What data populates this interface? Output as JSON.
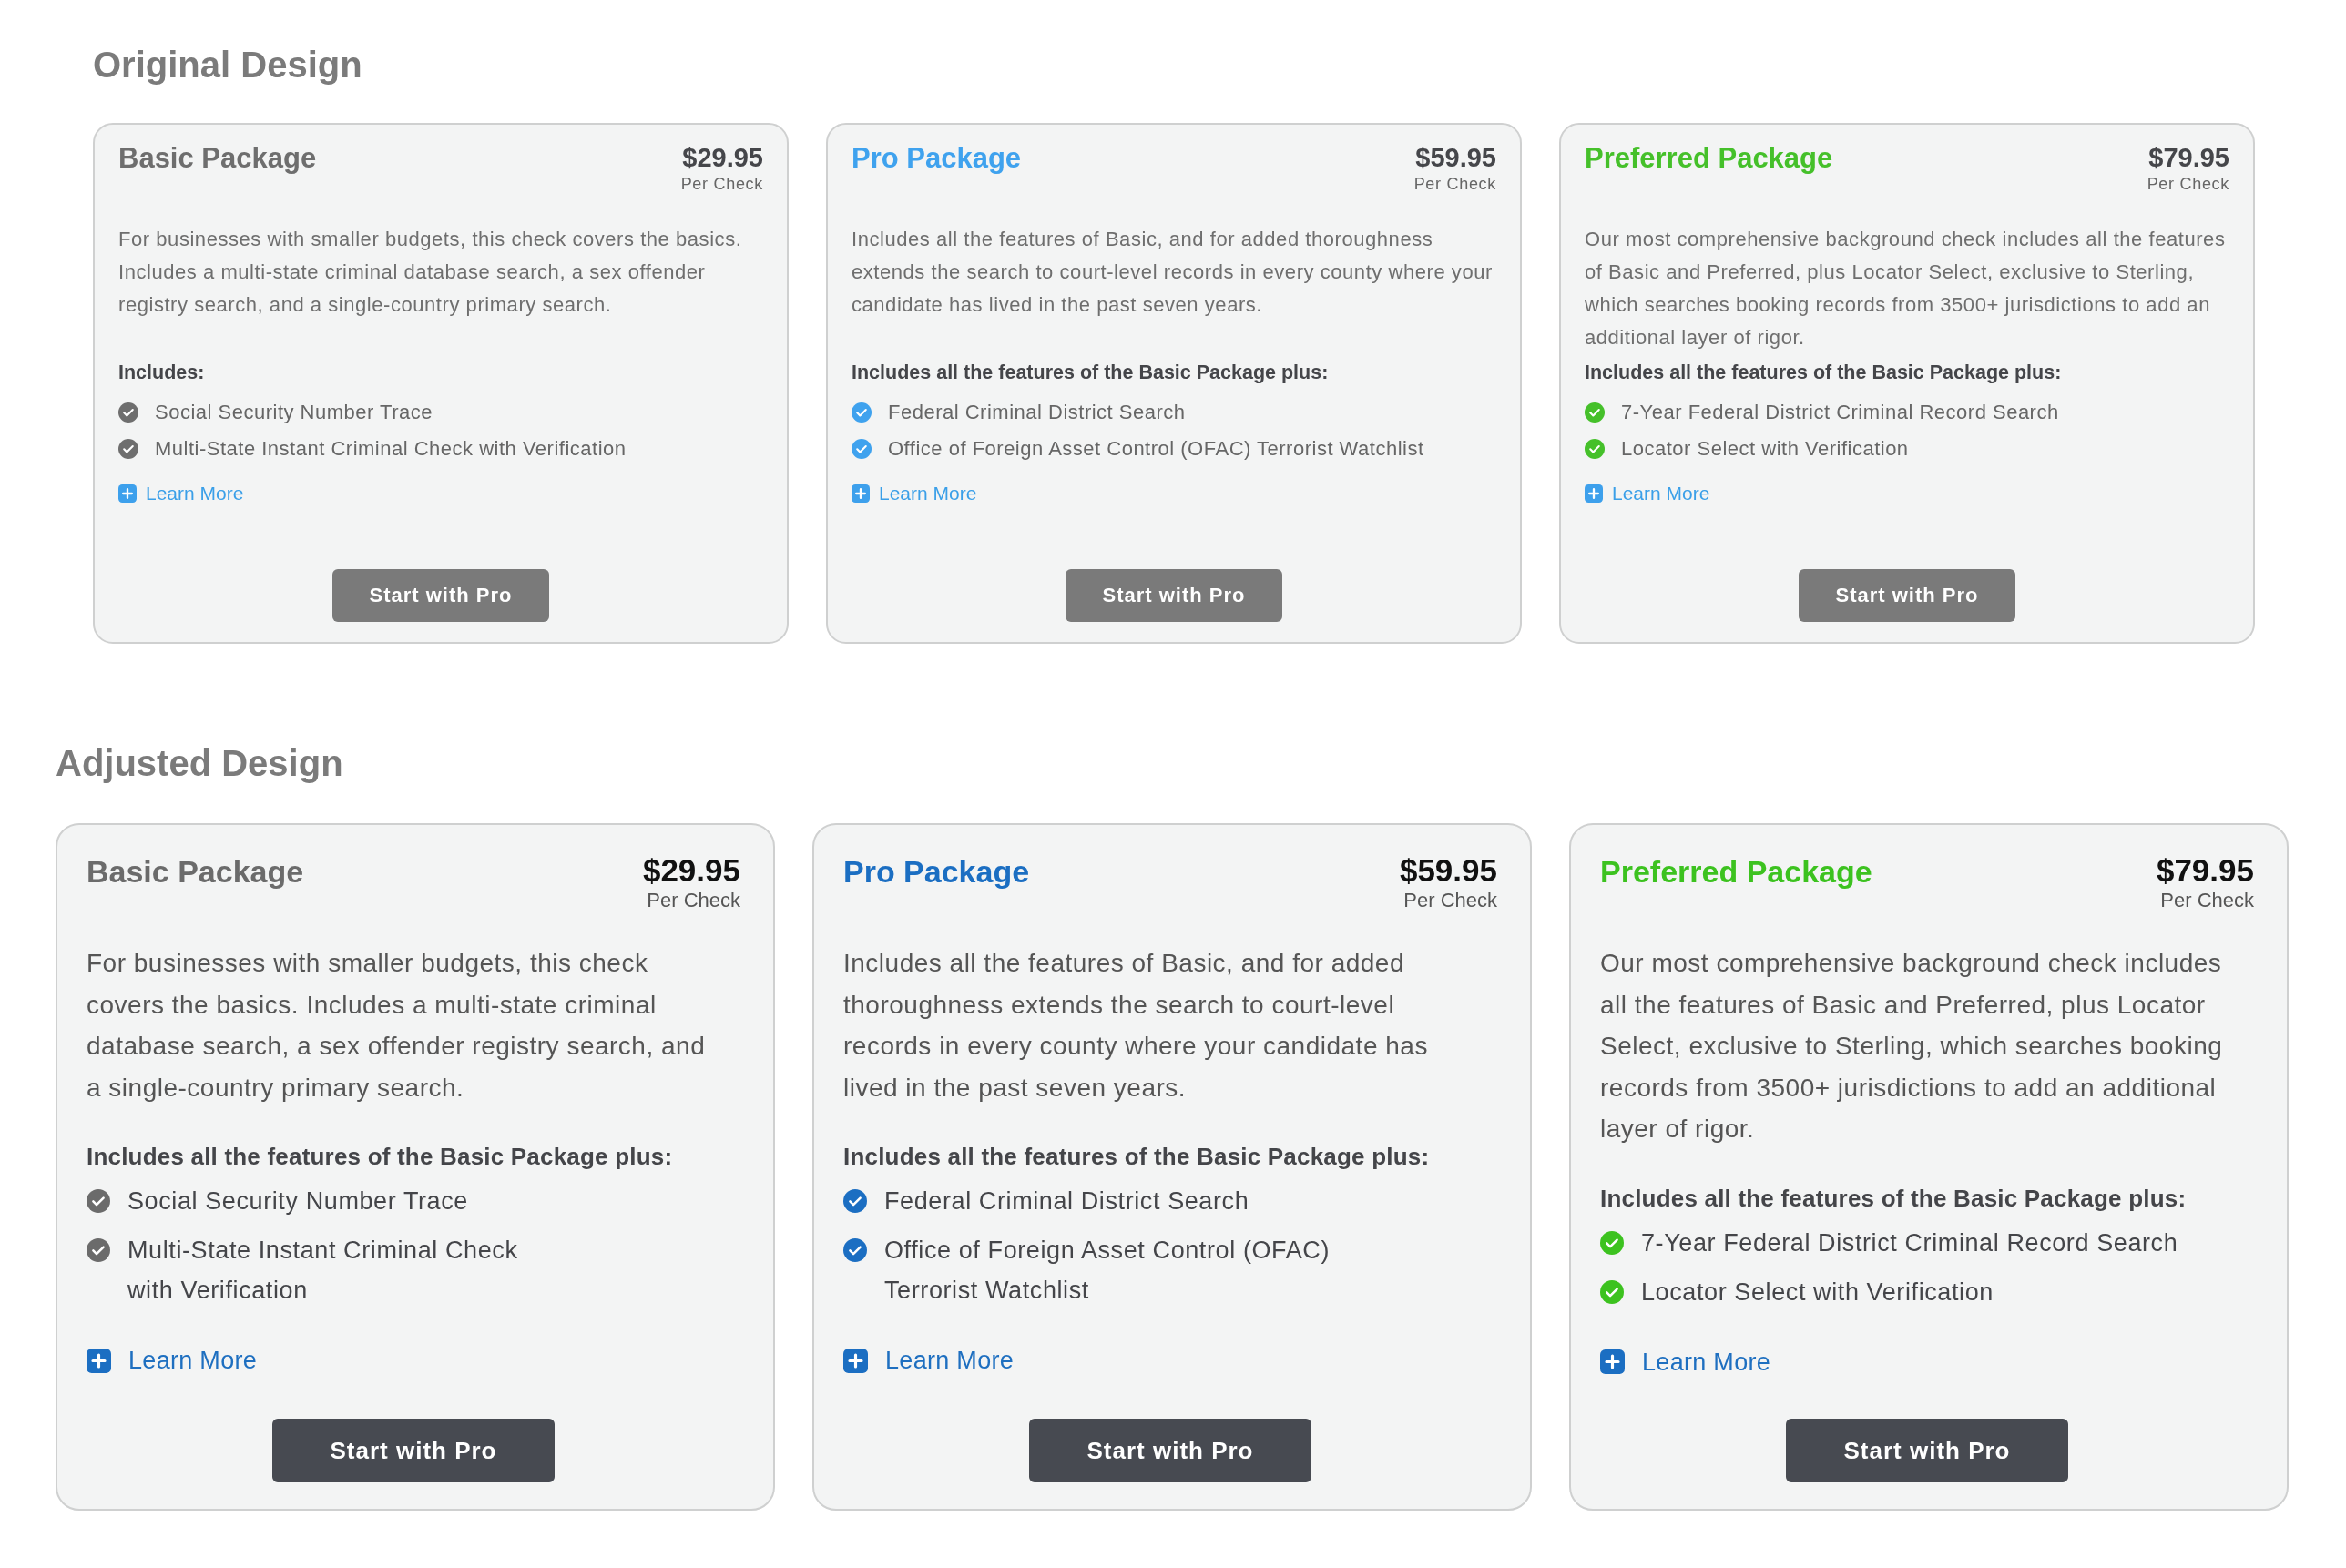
{
  "sections": [
    {
      "title": "Original Design",
      "kind": "small",
      "cards": [
        {
          "name": "Basic Package",
          "color": "#6e6e6e",
          "price": "$29.95",
          "price_unit": "Per Check",
          "description": "For businesses with smaller budgets, this check covers the basics. Includes a multi-state criminal database search, a sex offender registry search, and a single-country primary search.",
          "features_heading": "Includes:",
          "features": [
            "Social Security Number Trace",
            "Multi-State Instant Criminal Check with Verification"
          ],
          "link": "Learn More",
          "button": "Start with Pro"
        },
        {
          "name": "Pro Package",
          "color": "#3fa2ee",
          "price": "$59.95",
          "price_unit": "Per Check",
          "description": "Includes all the features of Basic, and for added thoroughness extends the search to court-level records in every county where your candidate has lived in the past seven years.",
          "features_heading": "Includes all the features of the Basic Package plus:",
          "features": [
            "Federal Criminal District Search",
            "Office of Foreign Asset Control (OFAC) Terrorist Watchlist"
          ],
          "link": "Learn More",
          "button": "Start with Pro"
        },
        {
          "name": "Preferred Package",
          "color": "#45c02a",
          "price": "$79.95",
          "price_unit": "Per Check",
          "description": "Our most comprehensive background check includes all the features of Basic and Preferred, plus Locator Select, exclusive to Sterling, which searches booking records from 3500+ jurisdictions to add an additional layer of rigor.",
          "features_heading": "Includes all the features of the Basic Package plus:",
          "features": [
            "7-Year Federal District Criminal Record Search",
            "Locator Select with Verification"
          ],
          "link": "Learn More",
          "button": "Start with Pro"
        }
      ]
    },
    {
      "title": "Adjusted Design",
      "kind": "large",
      "cards": [
        {
          "name": "Basic Package",
          "color": "#6b6b6b",
          "price": "$29.95",
          "price_unit": "Per Check",
          "description": "For businesses with smaller budgets, this check covers the basics. Includes a multi-state criminal database search, a sex offender registry search, and a single-country primary search.",
          "features_heading": "Includes all the features of the Basic Package plus:",
          "features": [
            "Social Security Number Trace",
            "Multi-State Instant Criminal Check\nwith Verification"
          ],
          "link": "Learn More",
          "button": "Start with Pro"
        },
        {
          "name": "Pro Package",
          "color": "#1b6ec2",
          "price": "$59.95",
          "price_unit": "Per Check",
          "description": "Includes all the features of Basic, and for added thoroughness extends the search to court-level records in every county where your candidate has lived in the past seven years.",
          "features_heading": "Includes all the features of the Basic Package plus:",
          "features": [
            "Federal Criminal District Search",
            "Office of Foreign Asset Control (OFAC)\nTerrorist Watchlist"
          ],
          "link": "Learn More",
          "button": "Start with Pro"
        },
        {
          "name": "Preferred Package",
          "color": "#3cc21f",
          "price": "$79.95",
          "price_unit": "Per Check",
          "description": "Our most comprehensive background check includes all the features of Basic and Preferred, plus Locator Select, exclusive to Sterling, which searches booking records from 3500+ jurisdictions to add an additional layer of rigor.",
          "features_heading": "Includes all the features of the Basic Package plus:",
          "features": [
            "7-Year Federal District Criminal Record Search",
            "Locator Select with Verification"
          ],
          "link": "Learn More",
          "button": "Start with Pro"
        }
      ]
    }
  ]
}
